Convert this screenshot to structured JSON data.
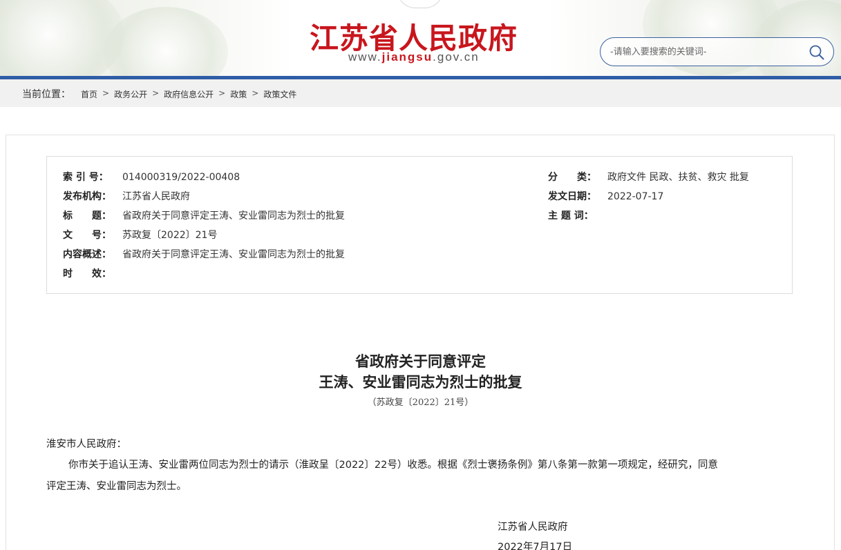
{
  "header": {
    "site_title": "江苏省人民政府",
    "url_prefix": "www.",
    "url_brand": "jiangsu",
    "url_suffix": ".gov.cn",
    "search_placeholder": "-请输入要搜索的关键词-",
    "brand_color": "#c8161d",
    "accent_color": "#2f5ca6"
  },
  "breadcrumb": {
    "label": "当前位置：",
    "items": [
      "首页",
      "政务公开",
      "政府信息公开",
      "政策",
      "政策文件"
    ],
    "separator": ">"
  },
  "meta": {
    "index_no": {
      "label": "索 引 号：",
      "value": "014000319/2022-00408"
    },
    "category": {
      "label": "分　　类：",
      "value": "政府文件 民政、扶贫、救灾 批复"
    },
    "publisher": {
      "label": "发布机构：",
      "value": "江苏省人民政府"
    },
    "issue_date": {
      "label": "发文日期：",
      "value": "2022-07-17"
    },
    "title": {
      "label": "标　　题：",
      "value": "省政府关于同意评定王涛、安业雷同志为烈士的批复"
    },
    "subject": {
      "label": "主 题 词：",
      "value": ""
    },
    "doc_no": {
      "label": "文　　号：",
      "value": "苏政复〔2022〕21号"
    },
    "summary": {
      "label": "内容概述：",
      "value": "省政府关于同意评定王涛、安业雷同志为烈士的批复"
    },
    "validity": {
      "label": "时　　效：",
      "value": ""
    }
  },
  "document": {
    "title_line1": "省政府关于同意评定",
    "title_line2": "王涛、安业雷同志为烈士的批复",
    "doc_number": "（苏政复〔2022〕21号）",
    "salutation": "淮安市人民政府：",
    "body_line1": "你市关于追认王涛、安业雷两位同志为烈士的请示（淮政呈〔2022〕22号）收悉。根据《烈士褒扬条例》第八条第一款第一项规定，经研究，同意",
    "body_line2": "评定王涛、安业雷同志为烈士。",
    "signature": "江苏省人民政府",
    "date": "2022年7月17日"
  }
}
